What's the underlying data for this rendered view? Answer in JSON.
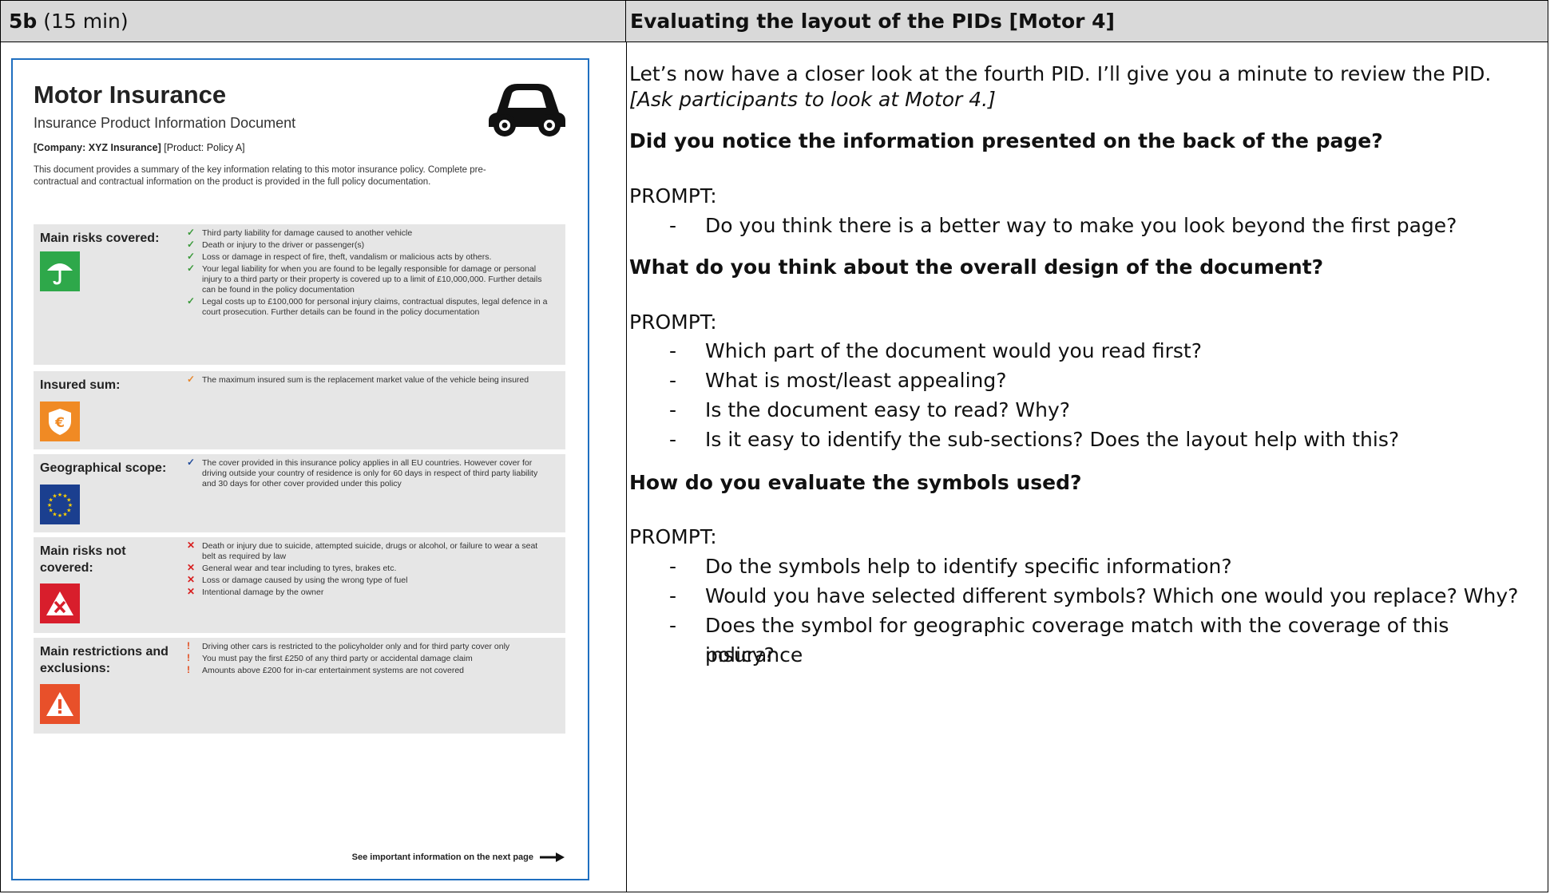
{
  "header": {
    "left_bold": "5b",
    "left_rest": " (15 min)",
    "right": "Evaluating the layout of the PIDs [Motor 4]"
  },
  "pid": {
    "title": "Motor Insurance",
    "subtitle": "Insurance Product Information Document",
    "company_bold": "[Company: XYZ Insurance]",
    "company_rest": " [Product: Policy A]",
    "intro": "This document provides a summary of the key information relating to this motor insurance policy. Complete pre-contractual and contractual information on the product is provided in the full policy documentation.",
    "sections": [
      {
        "label": "Main risks covered:",
        "items": [
          "Third party liability for damage caused to another vehicle",
          "Death or injury to the driver or passenger(s)",
          "Loss or damage in respect of fire, theft, vandalism or malicious acts by others.",
          "Your legal liability for when you are found to be legally responsible for damage or personal injury to a third party or their property is covered up to a limit of £10,000,000. Further details can be found in the policy documentation",
          "Legal costs up to £100,000 for personal injury claims, contractual disputes, legal defence in a court prosecution. Further details can be found in the policy documentation"
        ]
      },
      {
        "label": "Insured sum:",
        "items": [
          "The maximum insured sum is the replacement market value of the vehicle being insured"
        ]
      },
      {
        "label": "Geographical scope:",
        "items": [
          "The cover provided in this insurance policy applies in all EU countries. However cover for driving outside your country of residence is only for 60 days in respect of third party liability and 30 days for other cover provided under this policy"
        ]
      },
      {
        "label": "Main risks not covered:",
        "items": [
          "Death or injury due to suicide, attempted suicide, drugs or alcohol, or failure to wear a seat belt as required by law",
          "General wear and tear including to tyres, brakes etc.",
          "Loss or damage caused by using the wrong type of fuel",
          "Intentional damage by the owner"
        ]
      },
      {
        "label": "Main restrictions and exclusions:",
        "items": [
          "Driving other cars is restricted to the policyholder only and for third party cover only",
          "You must pay the first £250 of any third party or accidental damage claim",
          "Amounts above £200 for in-car entertainment systems are not covered"
        ]
      }
    ],
    "next_page": "See important information on the next page",
    "colors": {
      "covered_icon": "#2ea84a",
      "sum_icon": "#f08a24",
      "geo_icon": "#1b3f8f",
      "not_covered_icon": "#d81e2c",
      "restriction_icon": "#e8502a",
      "border": "#1f6fc0"
    }
  },
  "right": {
    "intro": "Let’s now have a closer look at the fourth PID. I’ll give you a minute to review the PID.",
    "intro_italic": "[Ask participants to look at Motor 4.]",
    "q1": "Did you notice the information presented on the back of the page?",
    "prompt1": "PROMPT:",
    "b1": [
      "Do you think there is a better way to make you look beyond the first page?"
    ],
    "q2": "What do you think about the overall design of the document?",
    "prompt2": "PROMPT:",
    "b2": [
      "Which part of the document would you read first?",
      "What is most/least appealing?",
      "Is the document easy to read? Why?",
      "Is it easy to identify the sub-sections? Does the layout help with this?"
    ],
    "q3": "How do you evaluate the symbols used?",
    "prompt3": "PROMPT:",
    "b3": [
      "Do the symbols help to identify specific information?",
      "Would you have selected different symbols? Which one would you replace? Why?",
      "Does the symbol for geographic coverage match with the coverage of this insurance",
      "policy?"
    ],
    "dash": "-"
  }
}
